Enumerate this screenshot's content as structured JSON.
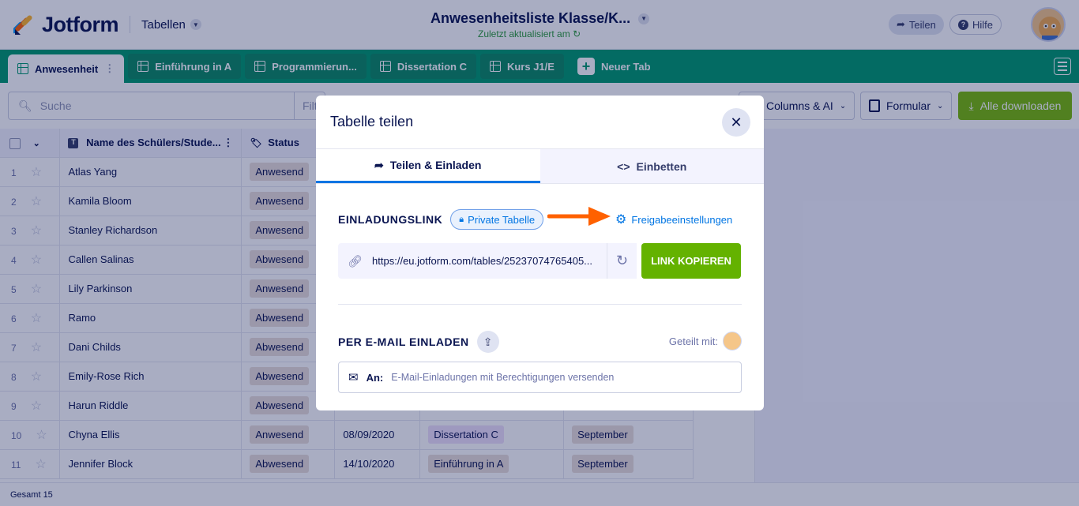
{
  "topbar": {
    "logo_text": "Jotform",
    "tables_dropdown": "Tabellen",
    "title": "Anwesenheitsliste Klasse/K...",
    "subtitle": "Zuletzt aktualisiert am",
    "share_label": "Teilen",
    "help_label": "Hilfe"
  },
  "tabs": [
    {
      "label": "Anwesenheit",
      "active": true
    },
    {
      "label": "Einführung in A",
      "active": false
    },
    {
      "label": "Programmierun...",
      "active": false
    },
    {
      "label": "Dissertation C",
      "active": false
    },
    {
      "label": "Kurs J1/E",
      "active": false
    }
  ],
  "new_tab_label": "Neuer Tab",
  "toolbar": {
    "search_placeholder": "Suche",
    "filter_partial": "Filt",
    "columns_label": "Columns & AI",
    "form_label": "Formular",
    "download_label": "Alle downloaden"
  },
  "grid": {
    "columns": [
      "Name des Schülers/Stude...",
      "Status"
    ],
    "rows": [
      {
        "num": "1",
        "name": "Atlas Yang",
        "status": "Anwesend"
      },
      {
        "num": "2",
        "name": "Kamila Bloom",
        "status": "Anwesend"
      },
      {
        "num": "3",
        "name": "Stanley Richardson",
        "status": "Anwesend"
      },
      {
        "num": "4",
        "name": "Callen Salinas",
        "status": "Abwesend"
      },
      {
        "num": "5",
        "name": "Lily Parkinson",
        "status": "Anwesend"
      },
      {
        "num": "6",
        "name": "Ramo",
        "status": "Abwesend"
      },
      {
        "num": "7",
        "name": "Dani Childs",
        "status": "Abwesend"
      },
      {
        "num": "8",
        "name": "Emily-Rose Rich",
        "status": "Abwesend"
      },
      {
        "num": "9",
        "name": "Harun Riddle",
        "status": "Abwesend",
        "date": "",
        "course": "",
        "month": ""
      },
      {
        "num": "10",
        "name": "Chyna Ellis",
        "status": "Anwesend",
        "date": "08/09/2020",
        "course": "Dissertation C",
        "month": "September"
      },
      {
        "num": "11",
        "name": "Jennifer Block",
        "status": "Abwesend",
        "date": "14/10/2020",
        "course": "Einführung in A",
        "month": "September"
      }
    ]
  },
  "footer": {
    "total": "Gesamt 15"
  },
  "modal": {
    "title": "Tabelle teilen",
    "tab_share": "Teilen & Einladen",
    "tab_embed": "Einbetten",
    "invite_link_label": "EINLADUNGSLINK",
    "private_badge": "Private Tabelle",
    "share_settings_link": "Freigabeeinstellungen",
    "link_url": "https://eu.jotform.com/tables/25237074765405...",
    "copy_button": "LINK KOPIEREN",
    "email_invite_label": "PER E-MAIL EINLADEN",
    "shared_with_label": "Geteilt mit:",
    "email_to_label": "An:",
    "email_placeholder": "E-Mail-Einladungen mit Berechtigungen versenden"
  },
  "colors": {
    "tab_bar": "#009a6e",
    "accent_blue": "#0075e3",
    "copy_green": "#64b200",
    "arrow_orange": "#ff6100",
    "overlay": "rgba(10,21,81,0.35)"
  }
}
